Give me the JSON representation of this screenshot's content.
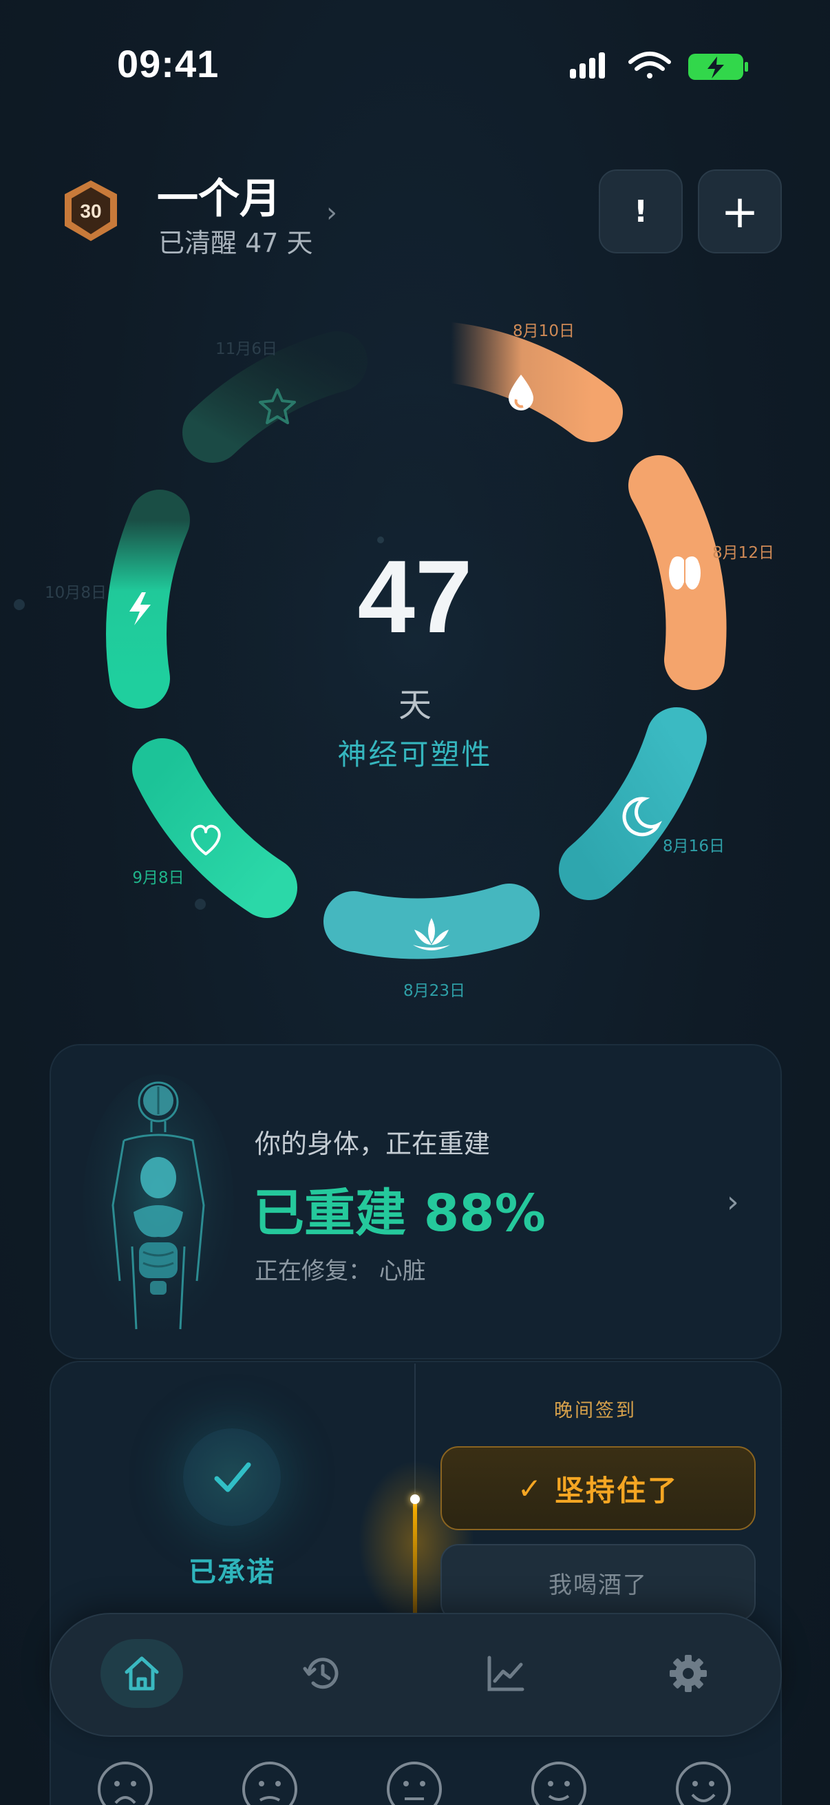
{
  "status_bar": {
    "time": "09:41"
  },
  "header": {
    "badge_number": "30",
    "title": "一个月",
    "subtitle": "已清醒 47 天",
    "alert_button": "!",
    "add_button": "+"
  },
  "ring": {
    "days": "47",
    "unit": "天",
    "phase": "神经可塑性",
    "milestones": [
      {
        "date": "8月10日",
        "icon": "drop-icon",
        "color": "#e8955f"
      },
      {
        "date": "8月12日",
        "icon": "brain-icon",
        "color": "#f0a16a"
      },
      {
        "date": "8月16日",
        "icon": "moon-icon",
        "color": "#3fb3bd"
      },
      {
        "date": "8月23日",
        "icon": "lotus-icon",
        "color": "#3fb3bd"
      },
      {
        "date": "9月8日",
        "icon": "heart-icon",
        "color": "#20c99a"
      },
      {
        "date": "10月8日",
        "icon": "bolt-icon",
        "color": "#20c99a"
      },
      {
        "date": "11月6日",
        "icon": "star-icon",
        "color": "#1c4d47"
      }
    ]
  },
  "body_card": {
    "eyebrow": "你的身体，正在重建",
    "title": "已重建 88%",
    "subtitle": "正在修复：  心脏"
  },
  "checkin": {
    "committed_label": "已承诺",
    "evening_label": "晚间签到",
    "hold_button": "坚持住了",
    "drank_button": "我喝酒了"
  },
  "tabs": [
    "home",
    "history",
    "stats",
    "settings"
  ],
  "moods": [
    "very-sad-face-icon",
    "sad-face-icon",
    "neutral-face-icon",
    "smile-face-icon",
    "happy-face-icon"
  ],
  "colors": {
    "accent_green": "#25c99c",
    "accent_teal": "#35b6be",
    "accent_orange": "#f5a623",
    "background": "#0f1b26"
  }
}
